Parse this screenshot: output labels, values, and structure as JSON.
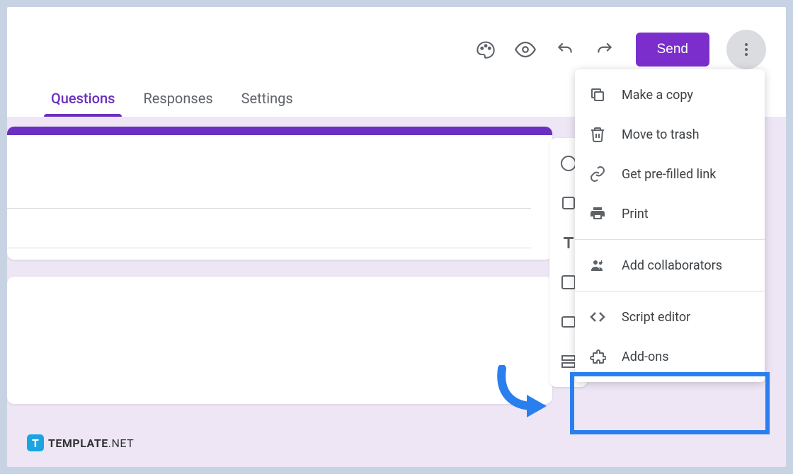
{
  "toolbar": {
    "send_label": "Send"
  },
  "tabs": {
    "questions": "Questions",
    "responses": "Responses",
    "settings": "Settings"
  },
  "menu": {
    "make_copy": "Make a copy",
    "move_trash": "Move to trash",
    "prefilled": "Get pre-filled link",
    "print": "Print",
    "collaborators": "Add collaborators",
    "script": "Script editor",
    "addons": "Add-ons"
  },
  "footer": {
    "badge": "T",
    "brand": "TEMPLATE",
    "tld": ".NET"
  }
}
